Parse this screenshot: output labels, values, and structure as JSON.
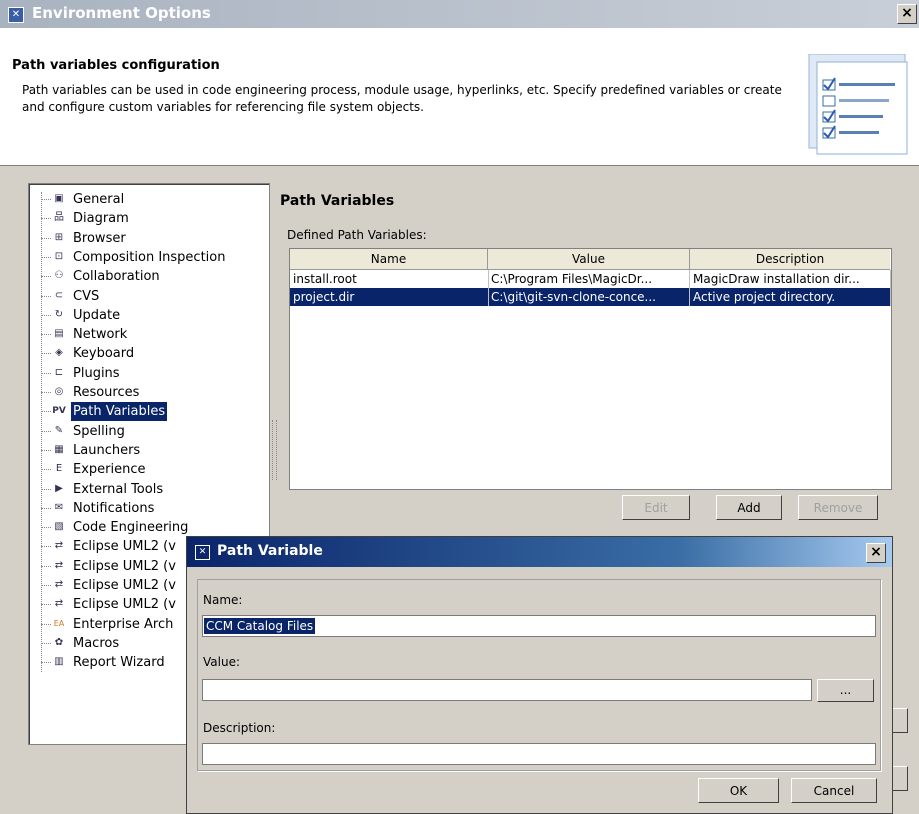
{
  "window": {
    "title": "Environment Options",
    "close_label": "×"
  },
  "header": {
    "title": "Path variables configuration",
    "description": "Path variables can be used in code engineering process, module usage, hyperlinks, etc. Specify predefined variables or create and configure custom variables for referencing file system objects."
  },
  "tree": {
    "items": [
      {
        "label": "General",
        "icon": "general-icon",
        "glyph": "▣"
      },
      {
        "label": "Diagram",
        "icon": "diagram-icon",
        "glyph": "品"
      },
      {
        "label": "Browser",
        "icon": "browser-icon",
        "glyph": "⊞"
      },
      {
        "label": "Composition Inspection",
        "icon": "composition-icon",
        "glyph": "⊡"
      },
      {
        "label": "Collaboration",
        "icon": "collaboration-icon",
        "glyph": "⚇"
      },
      {
        "label": "CVS",
        "icon": "cvs-icon",
        "glyph": "⊂"
      },
      {
        "label": "Update",
        "icon": "update-icon",
        "glyph": "↻"
      },
      {
        "label": "Network",
        "icon": "network-icon",
        "glyph": "▤"
      },
      {
        "label": "Keyboard",
        "icon": "keyboard-icon",
        "glyph": "◈"
      },
      {
        "label": "Plugins",
        "icon": "plugins-icon",
        "glyph": "⊏"
      },
      {
        "label": "Resources",
        "icon": "resources-icon",
        "glyph": "◎"
      },
      {
        "label": "Path Variables",
        "icon": "path-variables-icon",
        "glyph": "PV"
      },
      {
        "label": "Spelling",
        "icon": "spelling-icon",
        "glyph": "✎"
      },
      {
        "label": "Launchers",
        "icon": "launchers-icon",
        "glyph": "▦"
      },
      {
        "label": "Experience",
        "icon": "experience-icon",
        "glyph": "E"
      },
      {
        "label": "External Tools",
        "icon": "external-tools-icon",
        "glyph": "▶"
      },
      {
        "label": "Notifications",
        "icon": "notifications-icon",
        "glyph": "✉"
      },
      {
        "label": "Code Engineering",
        "icon": "code-engineering-icon",
        "glyph": "▧"
      },
      {
        "label": "Eclipse UML2 (v",
        "icon": "eclipse-uml2-icon",
        "glyph": "⇄"
      },
      {
        "label": "Eclipse UML2 (v",
        "icon": "eclipse-uml2-icon",
        "glyph": "⇄"
      },
      {
        "label": "Eclipse UML2 (v",
        "icon": "eclipse-uml2-icon",
        "glyph": "⇄"
      },
      {
        "label": "Eclipse UML2 (v",
        "icon": "eclipse-uml2-icon",
        "glyph": "⇄"
      },
      {
        "label": "Enterprise Arch",
        "icon": "enterprise-arch-icon",
        "glyph": "EA"
      },
      {
        "label": "Macros",
        "icon": "macros-icon",
        "glyph": "✿"
      },
      {
        "label": "Report Wizard",
        "icon": "report-wizard-icon",
        "glyph": "▥"
      }
    ],
    "selected_index": 11
  },
  "panel": {
    "title": "Path Variables",
    "subtitle": "Defined Path Variables:",
    "columns": [
      "Name",
      "Value",
      "Description"
    ],
    "rows": [
      {
        "name": "install.root",
        "value": "C:\\Program Files\\MagicDr...",
        "description": "MagicDraw installation dir..."
      },
      {
        "name": "project.dir",
        "value": "C:\\git\\git-svn-clone-conce...",
        "description": "Active project directory."
      }
    ],
    "selected_row": 1,
    "buttons": {
      "edit": "Edit",
      "add": "Add",
      "remove": "Remove"
    }
  },
  "dialog": {
    "title": "Path Variable",
    "close_label": "×",
    "name_label": "Name:",
    "name_value": "CCM Catalog Files",
    "value_label": "Value:",
    "value_value": "",
    "browse_label": "...",
    "description_label": "Description:",
    "description_value": "",
    "ok_label": "OK",
    "cancel_label": "Cancel"
  },
  "colors": {
    "selection": "#0a246a",
    "dialog_title_start": "#0a246a",
    "window_bg": "#d4d0c8"
  }
}
